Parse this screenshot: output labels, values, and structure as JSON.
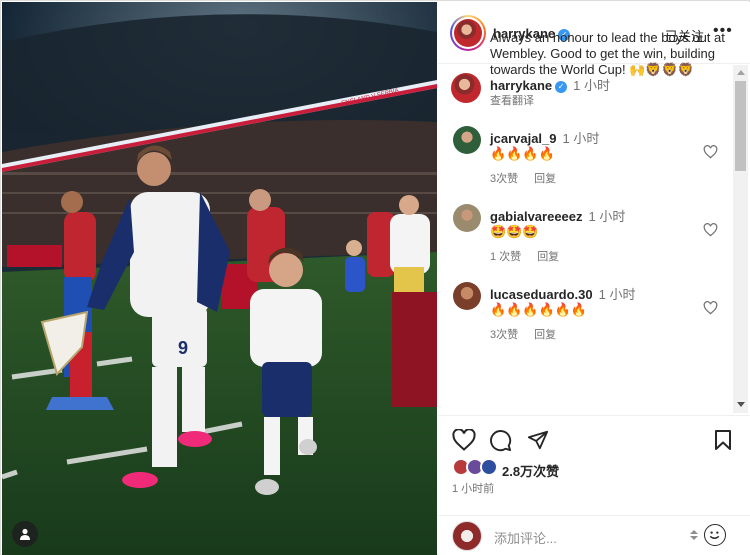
{
  "header": {
    "username": "harrykane",
    "verified": true,
    "follow_label": "已关注",
    "more_icon": "more-horizontal-icon"
  },
  "caption": {
    "username": "harrykane",
    "time": "1 小时",
    "text": "Always an honour to lead the boys out at Wembley. Good to get the win, building towards the World Cup! 🙌🦁🦁🦁",
    "translate_label": "查看翻译"
  },
  "comments": [
    {
      "username": "jcarvajal_9",
      "time": "1 小时",
      "text": "🔥🔥🔥🔥",
      "likes": "3次赞",
      "reply": "回复"
    },
    {
      "username": "gabialvareeeez",
      "time": "1 小时",
      "text": "🤩🤩🤩",
      "likes": "1 次赞",
      "reply": "回复"
    },
    {
      "username": "lucaseduardo.30",
      "time": "1 小时",
      "text": "🔥🔥🔥🔥🔥🔥",
      "likes": "3次赞",
      "reply": "回复"
    }
  ],
  "actions": {
    "like_icon": "heart-icon",
    "comment_icon": "comment-icon",
    "share_icon": "share-icon",
    "save_icon": "bookmark-icon",
    "likes_count": "2.8万次赞",
    "posted_ago": "1 小时前"
  },
  "composer": {
    "placeholder": "添加评论..."
  },
  "photo": {
    "banner_text": "ENGLAND V SERBIA",
    "user_tag_icon": "person-icon"
  },
  "colors": {
    "verified_blue": "#3897f0",
    "text_primary": "#262626",
    "text_secondary": "#737373",
    "border": "#dbdbdb"
  }
}
